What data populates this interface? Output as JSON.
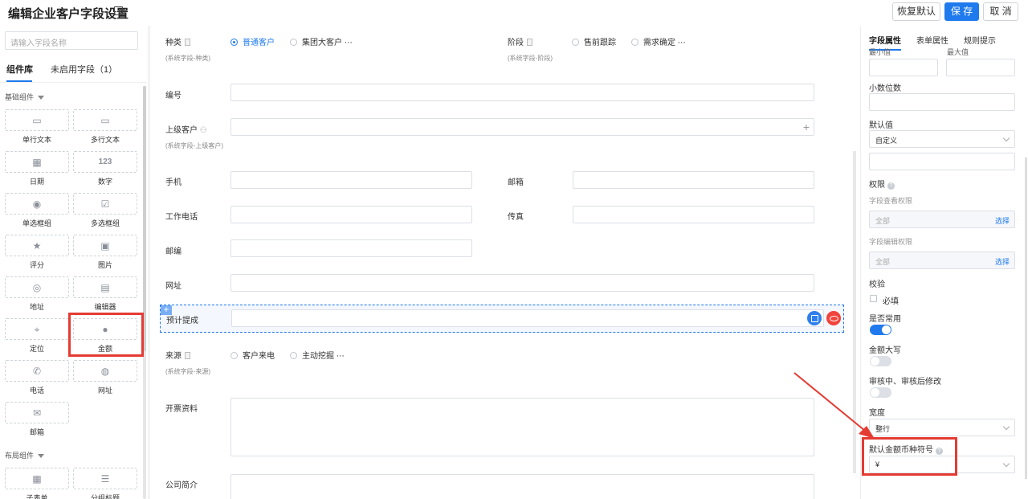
{
  "header": {
    "title": "编辑企业客户字段设置",
    "restore_label": "恢复默认",
    "save_label": "保 存",
    "cancel_label": "取 消"
  },
  "left": {
    "search_placeholder": "请输入字段名称",
    "tabs": [
      "组件库",
      "未启用字段（1）"
    ],
    "basic_group": "基础组件",
    "layout_group": "布局组件",
    "components": [
      {
        "label": "单行文本",
        "icon": "single-line-icon"
      },
      {
        "label": "多行文本",
        "icon": "multi-line-icon"
      },
      {
        "label": "日期",
        "icon": "calendar-icon"
      },
      {
        "label": "数字",
        "icon": "number-icon",
        "glyph": "123"
      },
      {
        "label": "单选框组",
        "icon": "radio-icon"
      },
      {
        "label": "多选框组",
        "icon": "checkbox-icon"
      },
      {
        "label": "评分",
        "icon": "star-icon"
      },
      {
        "label": "图片",
        "icon": "image-icon"
      },
      {
        "label": "地址",
        "icon": "location-icon"
      },
      {
        "label": "编辑器",
        "icon": "editor-icon"
      },
      {
        "label": "定位",
        "icon": "pin-icon"
      },
      {
        "label": "金额",
        "icon": "money-icon"
      },
      {
        "label": "电话",
        "icon": "phone-icon"
      },
      {
        "label": "网址",
        "icon": "globe-icon"
      },
      {
        "label": "邮箱",
        "icon": "mail-icon"
      }
    ],
    "layout_components": [
      {
        "label": "子表单",
        "icon": "table-icon"
      },
      {
        "label": "分组标题",
        "icon": "group-title-icon"
      }
    ]
  },
  "form": {
    "kind": {
      "label": "种类",
      "sub": "(系统字段-种类)",
      "options": [
        "普通客户",
        "集团大客户"
      ],
      "selected": "普通客户"
    },
    "stage": {
      "label": "阶段",
      "sub": "(系统字段-阶段)",
      "options": [
        "售前跟踪",
        "需求确定"
      ]
    },
    "number": {
      "label": "编号"
    },
    "parent": {
      "label": "上级客户",
      "sub": "(系统字段-上级客户)"
    },
    "mobile": {
      "label": "手机"
    },
    "email": {
      "label": "邮箱"
    },
    "work_phone": {
      "label": "工作电话"
    },
    "fax": {
      "label": "传真"
    },
    "zip": {
      "label": "邮编"
    },
    "website": {
      "label": "网址"
    },
    "commission": {
      "label": "预计提成"
    },
    "source": {
      "label": "来源",
      "sub": "(系统字段-来源)",
      "options": [
        "客户来电",
        "主动挖掘"
      ]
    },
    "invoice": {
      "label": "开票资料"
    },
    "intro": {
      "label": "公司简介"
    }
  },
  "right": {
    "tabs": [
      "字段属性",
      "表单属性",
      "规则提示"
    ],
    "min_label": "最小值",
    "max_label": "最大值",
    "decimal_label": "小数位数",
    "default_label": "默认值",
    "default_value": "自定义",
    "permission_label": "权限",
    "view_perm_label": "字段查看权限",
    "view_perm_value": "全部",
    "edit_perm_label": "字段编辑权限",
    "edit_perm_value": "全部",
    "choose_label": "选择",
    "validate_label": "校验",
    "required_label": "必填",
    "common_label": "是否常用",
    "common_on": true,
    "uppercase_label": "金额大写",
    "uppercase_on": false,
    "audit_label": "审核中、审核后修改",
    "audit_on": false,
    "width_label": "宽度",
    "width_value": "整行",
    "currency_label": "默认金额币种符号",
    "currency_value": "¥"
  },
  "colors": {
    "accent": "#1f7aed",
    "highlight": "#e43b33"
  }
}
